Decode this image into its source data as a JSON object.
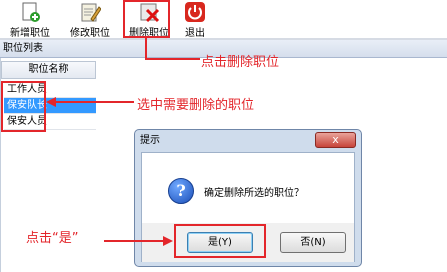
{
  "toolbar": {
    "items": [
      {
        "label": "新增职位",
        "icon": "add-document-icon"
      },
      {
        "label": "修改职位",
        "icon": "edit-note-icon"
      },
      {
        "label": "删除职位",
        "icon": "delete-x-icon"
      },
      {
        "label": "退出",
        "icon": "power-icon"
      }
    ]
  },
  "panel": {
    "title": "职位列表"
  },
  "grid": {
    "column_header": "职位名称",
    "rows": [
      "工作人员",
      "保安队长",
      "保安人员"
    ],
    "selected_index": 1
  },
  "annotations": {
    "click_delete": "点击删除职位",
    "select_position": "选中需要删除的职位",
    "click_yes": "点击“是”",
    "color": "#e3262b"
  },
  "dialog": {
    "title": "提示",
    "close": "x",
    "message": "确定删除所选的职位？",
    "yes": "是(Y)",
    "no": "否(N)",
    "icon": "question-icon"
  }
}
